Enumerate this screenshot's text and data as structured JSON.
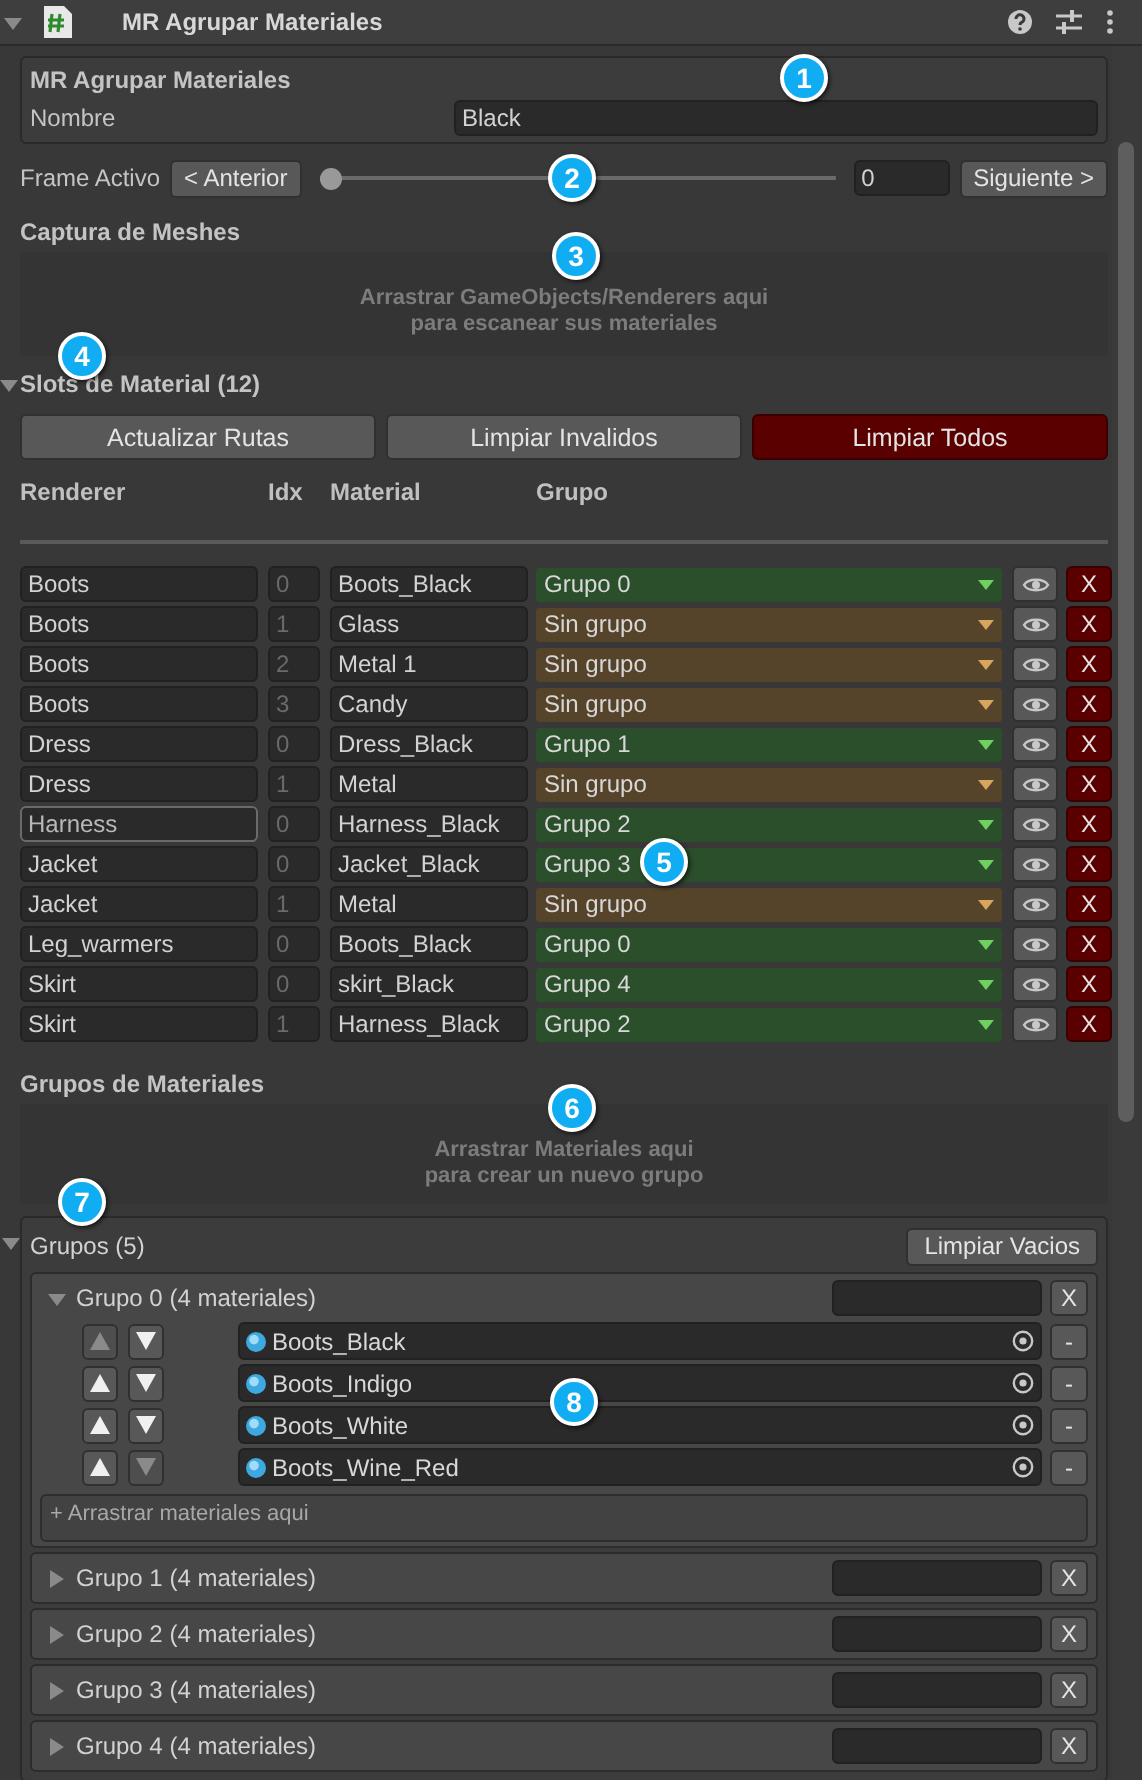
{
  "component": {
    "title": "MR Agrupar Materiales",
    "expanded": true
  },
  "settings": {
    "title": "MR Agrupar Materiales",
    "name_label": "Nombre",
    "name_value": "Black"
  },
  "frame": {
    "label": "Frame Activo",
    "prev_button": "< Anterior",
    "level": 0,
    "value": "0",
    "next_button": "Siguiente >"
  },
  "capture": {
    "title": "Captura de Meshes",
    "drop_text": [
      "Arrastrar GameObjects/Renderers aqui",
      "para escanear sus materiales"
    ]
  },
  "slots": {
    "title": "Slots de Material (12)",
    "expanded": true,
    "buttons": [
      {
        "label": "Actualizar Rutas",
        "kind": "normal"
      },
      {
        "label": "Limpiar Invalidos",
        "kind": "normal"
      },
      {
        "label": "Limpiar Todos",
        "kind": "danger"
      }
    ],
    "columns": [
      "Renderer",
      "Idx",
      "Material",
      "Grupo"
    ],
    "rows": [
      {
        "renderer": "Boots",
        "idx": "0",
        "material": "Boots_Black",
        "group": "Grupo 0",
        "assigned": true,
        "focused": false,
        "delete": "X"
      },
      {
        "renderer": "Boots",
        "idx": "1",
        "material": "Glass",
        "group": "Sin grupo",
        "assigned": false,
        "focused": false,
        "delete": "X"
      },
      {
        "renderer": "Boots",
        "idx": "2",
        "material": "Metal 1",
        "group": "Sin grupo",
        "assigned": false,
        "focused": false,
        "delete": "X"
      },
      {
        "renderer": "Boots",
        "idx": "3",
        "material": "Candy",
        "group": "Sin grupo",
        "assigned": false,
        "focused": false,
        "delete": "X"
      },
      {
        "renderer": "Dress",
        "idx": "0",
        "material": "Dress_Black",
        "group": "Grupo 1",
        "assigned": true,
        "focused": false,
        "delete": "X"
      },
      {
        "renderer": "Dress",
        "idx": "1",
        "material": "Metal",
        "group": "Sin grupo",
        "assigned": false,
        "focused": false,
        "delete": "X"
      },
      {
        "renderer": "Harness",
        "idx": "0",
        "material": "Harness_Black",
        "group": "Grupo 2",
        "assigned": true,
        "focused": true,
        "delete": "X"
      },
      {
        "renderer": "Jacket",
        "idx": "0",
        "material": "Jacket_Black",
        "group": "Grupo 3",
        "assigned": true,
        "focused": false,
        "delete": "X"
      },
      {
        "renderer": "Jacket",
        "idx": "1",
        "material": "Metal",
        "group": "Sin grupo",
        "assigned": false,
        "focused": false,
        "delete": "X"
      },
      {
        "renderer": "Leg_warmers",
        "idx": "0",
        "material": "Boots_Black",
        "group": "Grupo 0",
        "assigned": true,
        "focused": false,
        "delete": "X"
      },
      {
        "renderer": "Skirt",
        "idx": "0",
        "material": "skirt_Black",
        "group": "Grupo 4",
        "assigned": true,
        "focused": false,
        "delete": "X"
      },
      {
        "renderer": "Skirt",
        "idx": "1",
        "material": "Harness_Black",
        "group": "Grupo 2",
        "assigned": true,
        "focused": false,
        "delete": "X"
      }
    ]
  },
  "group_drop": {
    "title": "Grupos de Materiales",
    "drop_text": [
      "Arrastrar Materiales aqui",
      "para crear un nuevo grupo"
    ]
  },
  "groups": {
    "title": "Grupos (5)",
    "expanded": true,
    "clean_button": "Limpiar Vacios",
    "items": [
      {
        "title": "Grupo 0 (4 materiales)",
        "expanded": true,
        "delete": "X",
        "materials": [
          {
            "name": "Boots_Black",
            "up_disabled": true,
            "down_disabled": false,
            "remove": "-"
          },
          {
            "name": "Boots_Indigo",
            "up_disabled": false,
            "down_disabled": false,
            "remove": "-"
          },
          {
            "name": "Boots_White",
            "up_disabled": false,
            "down_disabled": false,
            "remove": "-"
          },
          {
            "name": "Boots_Wine_Red",
            "up_disabled": false,
            "down_disabled": true,
            "remove": "-"
          }
        ],
        "drop_text": "+ Arrastrar materiales aqui"
      },
      {
        "title": "Grupo 1 (4 materiales)",
        "expanded": false,
        "delete": "X"
      },
      {
        "title": "Grupo 2 (4 materiales)",
        "expanded": false,
        "delete": "X"
      },
      {
        "title": "Grupo 3 (4 materiales)",
        "expanded": false,
        "delete": "X"
      },
      {
        "title": "Grupo 4 (4 materiales)",
        "expanded": false,
        "delete": "X"
      }
    ]
  },
  "callouts": [
    "1",
    "2",
    "3",
    "4",
    "5",
    "6",
    "7",
    "8"
  ]
}
